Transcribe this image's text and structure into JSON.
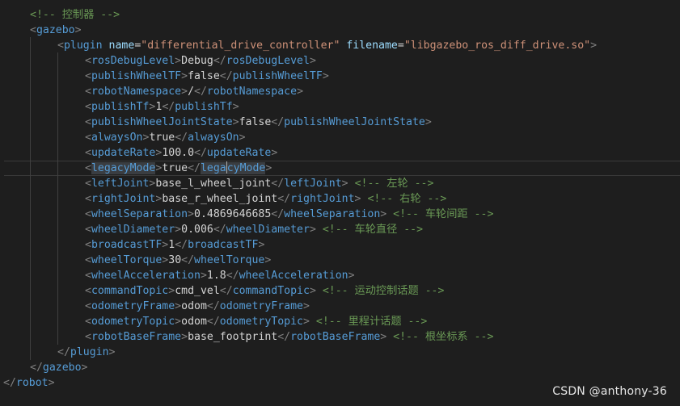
{
  "editor": {
    "lines": [
      [
        {
          "t": "<!-- 控制器 -->",
          "c": "comment"
        }
      ],
      [
        {
          "t": "<",
          "c": "punct"
        },
        {
          "t": "gazebo",
          "c": "tag"
        },
        {
          "t": ">",
          "c": "punct"
        }
      ],
      [
        {
          "t": "<",
          "c": "punct"
        },
        {
          "t": "plugin",
          "c": "tag"
        },
        {
          "t": " ",
          "c": "text"
        },
        {
          "t": "name",
          "c": "attr"
        },
        {
          "t": "=",
          "c": "text"
        },
        {
          "t": "\"differential_drive_controller\"",
          "c": "str"
        },
        {
          "t": " ",
          "c": "text"
        },
        {
          "t": "filename",
          "c": "attr"
        },
        {
          "t": "=",
          "c": "text"
        },
        {
          "t": "\"libgazebo_ros_diff_drive.so\"",
          "c": "str"
        },
        {
          "t": ">",
          "c": "punct"
        }
      ],
      [
        {
          "t": "<",
          "c": "punct"
        },
        {
          "t": "rosDebugLevel",
          "c": "tag"
        },
        {
          "t": ">",
          "c": "punct"
        },
        {
          "t": "Debug",
          "c": "text"
        },
        {
          "t": "</",
          "c": "punct"
        },
        {
          "t": "rosDebugLevel",
          "c": "tag"
        },
        {
          "t": ">",
          "c": "punct"
        }
      ],
      [
        {
          "t": "<",
          "c": "punct"
        },
        {
          "t": "publishWheelTF",
          "c": "tag"
        },
        {
          "t": ">",
          "c": "punct"
        },
        {
          "t": "false",
          "c": "text"
        },
        {
          "t": "</",
          "c": "punct"
        },
        {
          "t": "publishWheelTF",
          "c": "tag"
        },
        {
          "t": ">",
          "c": "punct"
        }
      ],
      [
        {
          "t": "<",
          "c": "punct"
        },
        {
          "t": "robotNamespace",
          "c": "tag"
        },
        {
          "t": ">",
          "c": "punct"
        },
        {
          "t": "/",
          "c": "text"
        },
        {
          "t": "</",
          "c": "punct"
        },
        {
          "t": "robotNamespace",
          "c": "tag"
        },
        {
          "t": ">",
          "c": "punct"
        }
      ],
      [
        {
          "t": "<",
          "c": "punct"
        },
        {
          "t": "publishTf",
          "c": "tag"
        },
        {
          "t": ">",
          "c": "punct"
        },
        {
          "t": "1",
          "c": "text"
        },
        {
          "t": "</",
          "c": "punct"
        },
        {
          "t": "publishTf",
          "c": "tag"
        },
        {
          "t": ">",
          "c": "punct"
        }
      ],
      [
        {
          "t": "<",
          "c": "punct"
        },
        {
          "t": "publishWheelJointState",
          "c": "tag"
        },
        {
          "t": ">",
          "c": "punct"
        },
        {
          "t": "false",
          "c": "text"
        },
        {
          "t": "</",
          "c": "punct"
        },
        {
          "t": "publishWheelJointState",
          "c": "tag"
        },
        {
          "t": ">",
          "c": "punct"
        }
      ],
      [
        {
          "t": "<",
          "c": "punct"
        },
        {
          "t": "alwaysOn",
          "c": "tag"
        },
        {
          "t": ">",
          "c": "punct"
        },
        {
          "t": "true",
          "c": "text"
        },
        {
          "t": "</",
          "c": "punct"
        },
        {
          "t": "alwaysOn",
          "c": "tag"
        },
        {
          "t": ">",
          "c": "punct"
        }
      ],
      [
        {
          "t": "<",
          "c": "punct"
        },
        {
          "t": "updateRate",
          "c": "tag"
        },
        {
          "t": ">",
          "c": "punct"
        },
        {
          "t": "100.0",
          "c": "text"
        },
        {
          "t": "</",
          "c": "punct"
        },
        {
          "t": "updateRate",
          "c": "tag"
        },
        {
          "t": ">",
          "c": "punct"
        }
      ],
      [
        {
          "t": "<",
          "c": "punct"
        },
        {
          "t": "legacyMode",
          "c": "tag",
          "sel": true
        },
        {
          "t": ">",
          "c": "punct"
        },
        {
          "t": "true",
          "c": "text"
        },
        {
          "t": "</",
          "c": "punct"
        },
        {
          "t": "lega",
          "c": "tag",
          "sel": true
        },
        {
          "t": "",
          "c": "cursor"
        },
        {
          "t": "cyMode",
          "c": "tag",
          "sel": true
        },
        {
          "t": ">",
          "c": "punct"
        }
      ],
      [
        {
          "t": "<",
          "c": "punct"
        },
        {
          "t": "leftJoint",
          "c": "tag"
        },
        {
          "t": ">",
          "c": "punct"
        },
        {
          "t": "base_l_wheel_joint",
          "c": "text"
        },
        {
          "t": "</",
          "c": "punct"
        },
        {
          "t": "leftJoint",
          "c": "tag"
        },
        {
          "t": ">",
          "c": "punct"
        },
        {
          "t": " ",
          "c": "text"
        },
        {
          "t": "<!-- 左轮 -->",
          "c": "comment"
        }
      ],
      [
        {
          "t": "<",
          "c": "punct"
        },
        {
          "t": "rightJoint",
          "c": "tag"
        },
        {
          "t": ">",
          "c": "punct"
        },
        {
          "t": "base_r_wheel_joint",
          "c": "text"
        },
        {
          "t": "</",
          "c": "punct"
        },
        {
          "t": "rightJoint",
          "c": "tag"
        },
        {
          "t": ">",
          "c": "punct"
        },
        {
          "t": " ",
          "c": "text"
        },
        {
          "t": "<!-- 右轮 -->",
          "c": "comment"
        }
      ],
      [
        {
          "t": "<",
          "c": "punct"
        },
        {
          "t": "wheelSeparation",
          "c": "tag"
        },
        {
          "t": ">",
          "c": "punct"
        },
        {
          "t": "0.4869646685",
          "c": "text"
        },
        {
          "t": "</",
          "c": "punct"
        },
        {
          "t": "wheelSeparation",
          "c": "tag"
        },
        {
          "t": ">",
          "c": "punct"
        },
        {
          "t": " ",
          "c": "text"
        },
        {
          "t": "<!-- 车轮间距 -->",
          "c": "comment"
        }
      ],
      [
        {
          "t": "<",
          "c": "punct"
        },
        {
          "t": "wheelDiameter",
          "c": "tag"
        },
        {
          "t": ">",
          "c": "punct"
        },
        {
          "t": "0.006",
          "c": "text"
        },
        {
          "t": "</",
          "c": "punct"
        },
        {
          "t": "wheelDiameter",
          "c": "tag"
        },
        {
          "t": ">",
          "c": "punct"
        },
        {
          "t": " ",
          "c": "text"
        },
        {
          "t": "<!-- 车轮直径 -->",
          "c": "comment"
        }
      ],
      [
        {
          "t": "<",
          "c": "punct"
        },
        {
          "t": "broadcastTF",
          "c": "tag"
        },
        {
          "t": ">",
          "c": "punct"
        },
        {
          "t": "1",
          "c": "text"
        },
        {
          "t": "</",
          "c": "punct"
        },
        {
          "t": "broadcastTF",
          "c": "tag"
        },
        {
          "t": ">",
          "c": "punct"
        }
      ],
      [
        {
          "t": "<",
          "c": "punct"
        },
        {
          "t": "wheelTorque",
          "c": "tag"
        },
        {
          "t": ">",
          "c": "punct"
        },
        {
          "t": "30",
          "c": "text"
        },
        {
          "t": "</",
          "c": "punct"
        },
        {
          "t": "wheelTorque",
          "c": "tag"
        },
        {
          "t": ">",
          "c": "punct"
        }
      ],
      [
        {
          "t": "<",
          "c": "punct"
        },
        {
          "t": "wheelAcceleration",
          "c": "tag"
        },
        {
          "t": ">",
          "c": "punct"
        },
        {
          "t": "1.8",
          "c": "text"
        },
        {
          "t": "</",
          "c": "punct"
        },
        {
          "t": "wheelAcceleration",
          "c": "tag"
        },
        {
          "t": ">",
          "c": "punct"
        }
      ],
      [
        {
          "t": "<",
          "c": "punct"
        },
        {
          "t": "commandTopic",
          "c": "tag"
        },
        {
          "t": ">",
          "c": "punct"
        },
        {
          "t": "cmd_vel",
          "c": "text"
        },
        {
          "t": "</",
          "c": "punct"
        },
        {
          "t": "commandTopic",
          "c": "tag"
        },
        {
          "t": ">",
          "c": "punct"
        },
        {
          "t": " ",
          "c": "text"
        },
        {
          "t": "<!-- 运动控制话题 -->",
          "c": "comment"
        }
      ],
      [
        {
          "t": "<",
          "c": "punct"
        },
        {
          "t": "odometryFrame",
          "c": "tag"
        },
        {
          "t": ">",
          "c": "punct"
        },
        {
          "t": "odom",
          "c": "text"
        },
        {
          "t": "</",
          "c": "punct"
        },
        {
          "t": "odometryFrame",
          "c": "tag"
        },
        {
          "t": ">",
          "c": "punct"
        }
      ],
      [
        {
          "t": "<",
          "c": "punct"
        },
        {
          "t": "odometryTopic",
          "c": "tag"
        },
        {
          "t": ">",
          "c": "punct"
        },
        {
          "t": "odom",
          "c": "text"
        },
        {
          "t": "</",
          "c": "punct"
        },
        {
          "t": "odometryTopic",
          "c": "tag"
        },
        {
          "t": ">",
          "c": "punct"
        },
        {
          "t": " ",
          "c": "text"
        },
        {
          "t": "<!-- 里程计话题 -->",
          "c": "comment"
        }
      ],
      [
        {
          "t": "<",
          "c": "punct"
        },
        {
          "t": "robotBaseFrame",
          "c": "tag"
        },
        {
          "t": ">",
          "c": "punct"
        },
        {
          "t": "base_footprint",
          "c": "text"
        },
        {
          "t": "</",
          "c": "punct"
        },
        {
          "t": "robotBaseFrame",
          "c": "tag"
        },
        {
          "t": ">",
          "c": "punct"
        },
        {
          "t": " ",
          "c": "text"
        },
        {
          "t": "<!-- 根坐标系 -->",
          "c": "comment"
        }
      ],
      [
        {
          "t": "</",
          "c": "punct"
        },
        {
          "t": "plugin",
          "c": "tag"
        },
        {
          "t": ">",
          "c": "punct"
        }
      ],
      [
        {
          "t": "</",
          "c": "punct"
        },
        {
          "t": "gazebo",
          "c": "tag"
        },
        {
          "t": ">",
          "c": "punct"
        }
      ],
      [
        {
          "t": "</",
          "c": "punct"
        },
        {
          "t": "robot",
          "c": "tag"
        },
        {
          "t": ">",
          "c": "punct"
        }
      ]
    ]
  },
  "watermark": "CSDN @anthony-36"
}
